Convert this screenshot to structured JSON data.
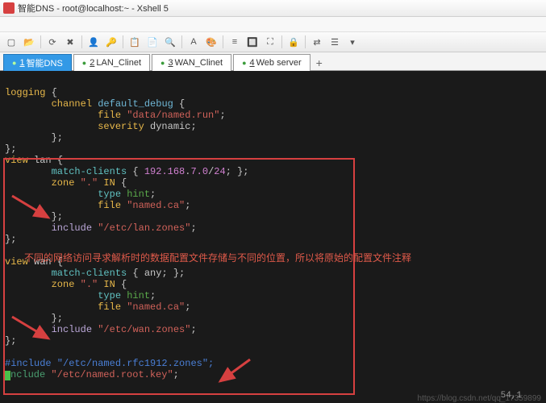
{
  "window": {
    "title": "智能DNS - root@localhost:~ - Xshell 5"
  },
  "tabs": {
    "items": [
      {
        "num": "1",
        "label": "智能DNS",
        "active": true
      },
      {
        "num": "2",
        "label": "LAN_Clinet",
        "active": false
      },
      {
        "num": "3",
        "label": "WAN_Clinet",
        "active": false
      },
      {
        "num": "4",
        "label": "Web server",
        "active": false
      }
    ]
  },
  "code": {
    "l1a": "logging",
    "l1b": " {",
    "l2a": "        channel",
    "l2b": " default_debug",
    "l2c": " {",
    "l3a": "                file",
    "l3b": " \"data/named.run\"",
    "l3c": ";",
    "l4a": "                severity",
    "l4b": " dynamic",
    "l4c": ";",
    "l5": "        };",
    "l6": "};",
    "l7a": "view",
    "l7b": " lan {",
    "l8a": "        match-clients",
    "l8b": " { ",
    "l8c": "192.168",
    "l8d": ".",
    "l8e": "7.0",
    "l8f": "/",
    "l8g": "24",
    "l8h": "; };",
    "l9a": "        zone",
    "l9b": " \".\"",
    "l9c": " IN",
    "l9d": " {",
    "l10a": "                type",
    "l10b": " hint",
    "l10c": ";",
    "l11a": "                file",
    "l11b": " \"named.ca\"",
    "l11c": ";",
    "l12": "        };",
    "l13a": "        include",
    "l13b": " \"/etc/lan.zones\"",
    "l13c": ";",
    "l14": "};",
    "l16a": "view",
    "l16b": " wan {",
    "l17a": "        match-clients",
    "l17b": " { any; };",
    "l18a": "        zone",
    "l18b": " \".\"",
    "l18c": " IN",
    "l18d": " {",
    "l19a": "                type",
    "l19b": " hint",
    "l19c": ";",
    "l20a": "                file",
    "l20b": " \"named.ca\"",
    "l20c": ";",
    "l21": "        };",
    "l22a": "        include",
    "l22b": " \"/etc/wan.zones\"",
    "l22c": ";",
    "l23": "};",
    "l25": "#include \"/etc/named.rfc1912.zones\";",
    "l26a": "nclude",
    "l26b": " \"/etc/named.root.key\"",
    "l26c": ";"
  },
  "annotation": "不同的网络访问寻求解析时的数据配置文件存储与不同的位置，所以将原始的配置文件注释",
  "status": "54,1",
  "watermark": "https://blog.csdn.net/qq_17359899"
}
